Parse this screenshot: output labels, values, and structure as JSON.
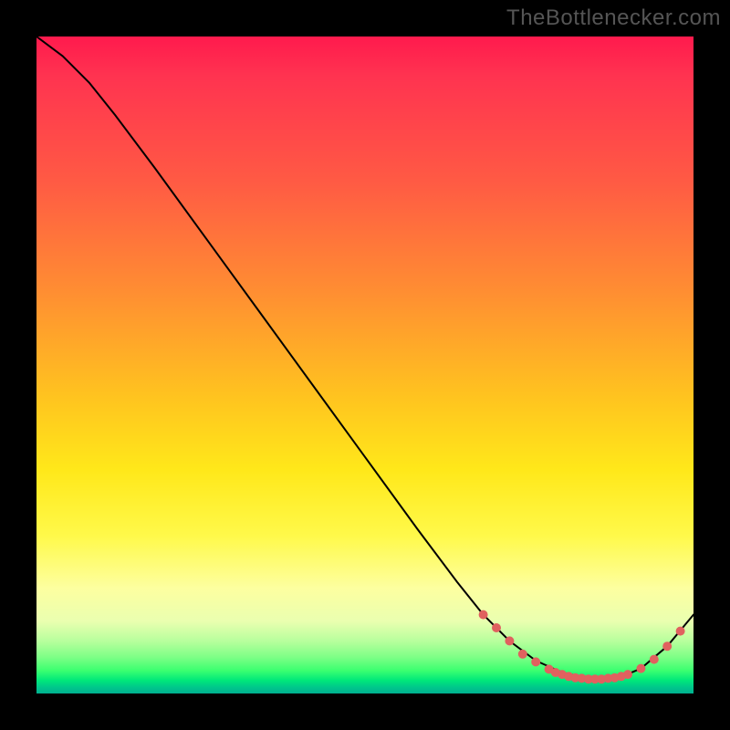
{
  "watermark": "TheBottlenecker.com",
  "colors": {
    "curve_stroke": "#000000",
    "dot_fill": "#e0615f",
    "page_bg": "#000000"
  },
  "chart_data": {
    "type": "line",
    "title": "",
    "xlabel": "",
    "ylabel": "",
    "xlim": [
      0,
      100
    ],
    "ylim": [
      0,
      100
    ],
    "series": [
      {
        "name": "curve",
        "x": [
          0,
          4,
          8,
          12,
          18,
          26,
          34,
          42,
          50,
          58,
          64,
          68,
          72,
          76,
          80,
          84,
          88,
          92,
          96,
          100
        ],
        "y": [
          100,
          97,
          93,
          88,
          80,
          69,
          58,
          47,
          36,
          25,
          17,
          12,
          8,
          5,
          3.2,
          2.3,
          2.1,
          3.8,
          7.2,
          12
        ]
      }
    ],
    "markers": [
      {
        "x": 68,
        "y": 12
      },
      {
        "x": 70,
        "y": 10
      },
      {
        "x": 72,
        "y": 8
      },
      {
        "x": 74,
        "y": 6
      },
      {
        "x": 76,
        "y": 4.8
      },
      {
        "x": 78,
        "y": 3.7
      },
      {
        "x": 79,
        "y": 3.2
      },
      {
        "x": 80,
        "y": 2.9
      },
      {
        "x": 81,
        "y": 2.6
      },
      {
        "x": 82,
        "y": 2.4
      },
      {
        "x": 83,
        "y": 2.3
      },
      {
        "x": 84,
        "y": 2.2
      },
      {
        "x": 85,
        "y": 2.2
      },
      {
        "x": 86,
        "y": 2.2
      },
      {
        "x": 87,
        "y": 2.3
      },
      {
        "x": 88,
        "y": 2.4
      },
      {
        "x": 89,
        "y": 2.6
      },
      {
        "x": 90,
        "y": 2.9
      },
      {
        "x": 92,
        "y": 3.8
      },
      {
        "x": 94,
        "y": 5.2
      },
      {
        "x": 96,
        "y": 7.2
      },
      {
        "x": 98,
        "y": 9.5
      }
    ],
    "dot_radius": 4.5,
    "gradient_bands": [
      {
        "pos": 0,
        "color": "#ff1a4d"
      },
      {
        "pos": 0.4,
        "color": "#ff8b33"
      },
      {
        "pos": 0.66,
        "color": "#ffe81a"
      },
      {
        "pos": 0.9,
        "color": "#b8ff9d"
      },
      {
        "pos": 1.0,
        "color": "#00b090"
      }
    ]
  }
}
